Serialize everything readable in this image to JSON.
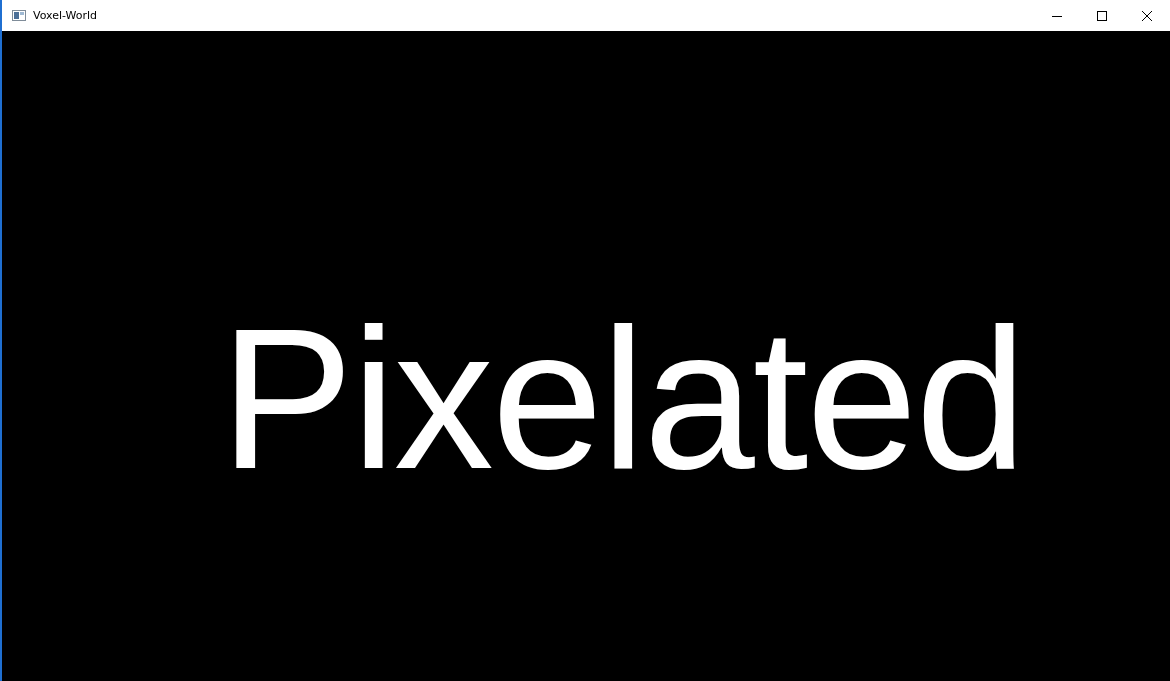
{
  "window": {
    "title": "Voxel-World"
  },
  "canvas": {
    "text": "Pixelated"
  }
}
